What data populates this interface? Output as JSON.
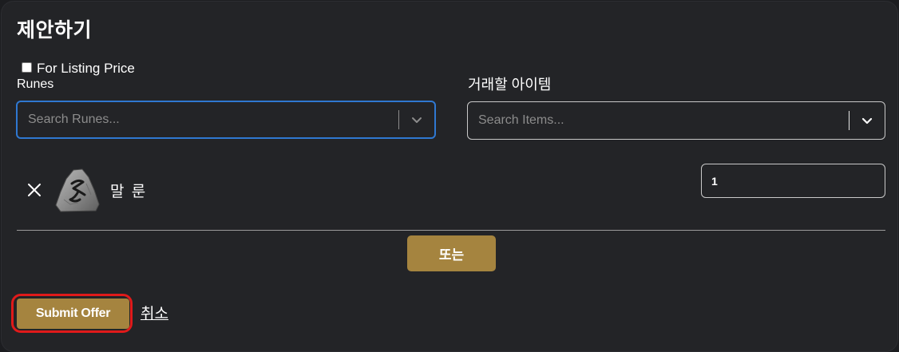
{
  "title": "제안하기",
  "listing": {
    "checkbox_checked": false,
    "label": "For Listing Price"
  },
  "runes_field": {
    "label": "Runes",
    "placeholder": "Search Runes..."
  },
  "items_field": {
    "label": "거래할 아이템",
    "placeholder": "Search Items..."
  },
  "selected_rune": {
    "name": "말 룬",
    "quantity": "1",
    "icon": "rune-stone-icon"
  },
  "or_button_label": "또는",
  "submit_label": "Submit Offer",
  "cancel_label": "취소",
  "colors": {
    "accent_gold": "#a5843f",
    "focus_blue": "#2f78d1",
    "highlight_red": "#e01a1a",
    "panel_bg": "#232427"
  }
}
